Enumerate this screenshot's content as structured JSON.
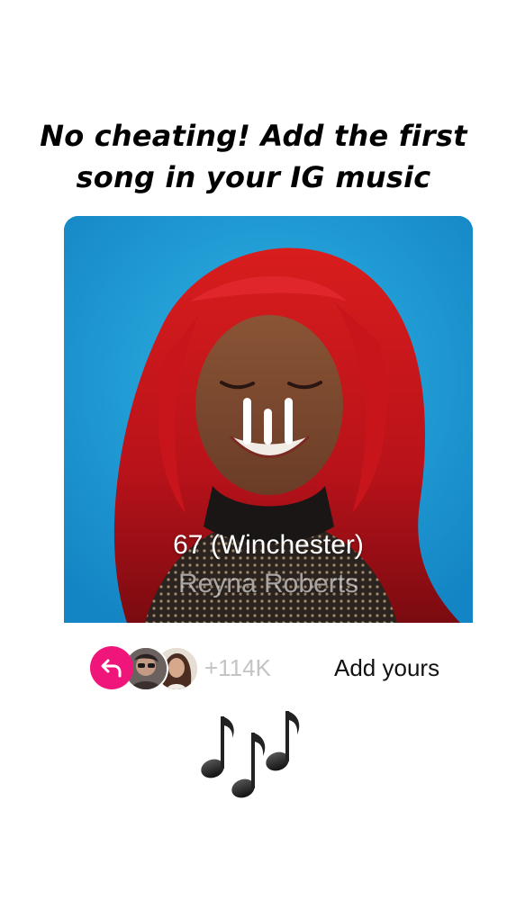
{
  "prompt": {
    "line1": "No cheating! Add the first",
    "line2": "song in your IG music"
  },
  "music_card": {
    "song_title": "67 (Winchester)",
    "artist": "Reyna Roberts",
    "artwork_icon": "album-artwork-portrait",
    "playback_icon": "pause-icon",
    "background_color": "#1d9fd6"
  },
  "add_yours": {
    "count": "+114K",
    "button_label": "Add yours",
    "share_icon": "reply-arrow-icon",
    "share_color": "#f0157a"
  },
  "decoration": {
    "emoji_icon": "musical-notes-icon"
  }
}
